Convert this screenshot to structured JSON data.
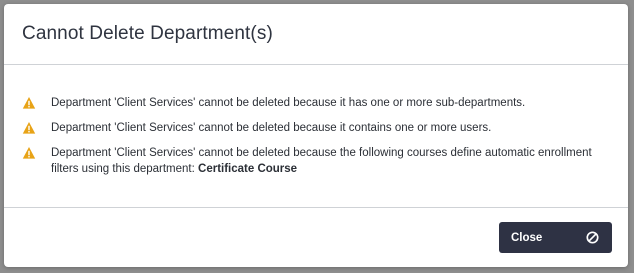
{
  "dialog": {
    "title": "Cannot Delete Department(s)",
    "messages": [
      {
        "icon": "warning-icon",
        "text": "Department 'Client Services' cannot be deleted because it has one or more sub-departments."
      },
      {
        "icon": "warning-icon",
        "text": "Department 'Client Services' cannot be deleted because it contains one or more users."
      },
      {
        "icon": "warning-icon",
        "text": "Department 'Client Services' cannot be deleted because the following courses define automatic enrollment filters using this department: ",
        "bold": "Certificate Course"
      }
    ],
    "close_label": "Close",
    "close_icon": "ban-icon"
  },
  "colors": {
    "warning": "#e8a317",
    "button_bg": "#2e3244",
    "backdrop": "#8e8e8e"
  }
}
